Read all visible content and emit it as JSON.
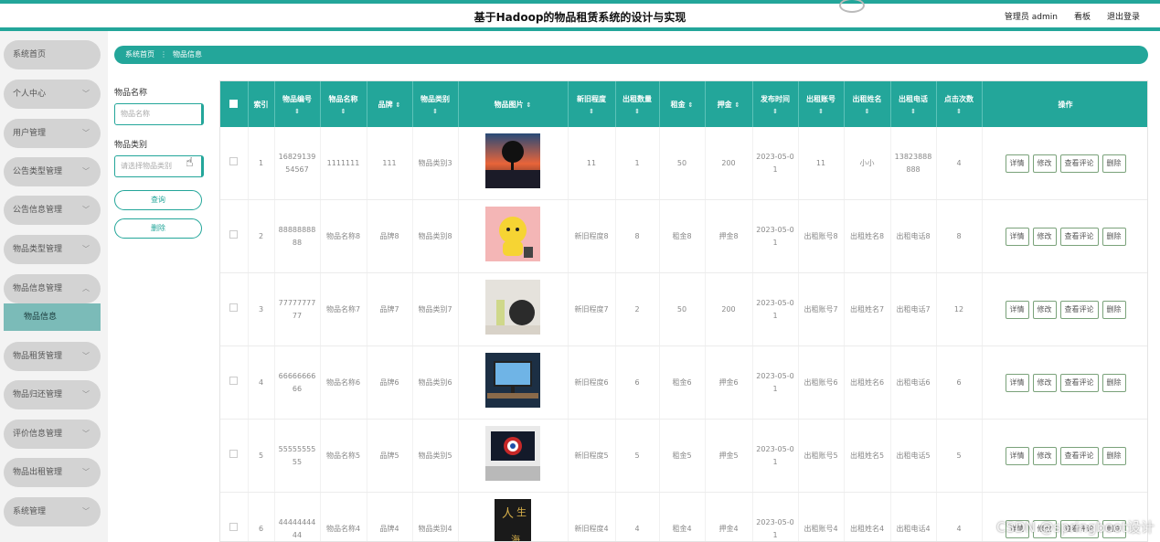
{
  "header": {
    "title": "基于Hadoop的物品租赁系统的设计与实现",
    "user": "管理员 admin",
    "board": "看板",
    "logout": "退出登录"
  },
  "sidebar": {
    "items": [
      {
        "label": "系统首页",
        "chevron": ""
      },
      {
        "label": "个人中心",
        "chevron": "﹀"
      },
      {
        "label": "用户管理",
        "chevron": "﹀"
      },
      {
        "label": "公告类型管理",
        "chevron": "﹀"
      },
      {
        "label": "公告信息管理",
        "chevron": "﹀"
      },
      {
        "label": "物品类型管理",
        "chevron": "﹀"
      },
      {
        "label": "物品信息管理",
        "chevron": "︿"
      },
      {
        "label": "物品租赁管理",
        "chevron": "﹀"
      },
      {
        "label": "物品归还管理",
        "chevron": "﹀"
      },
      {
        "label": "评价信息管理",
        "chevron": "﹀"
      },
      {
        "label": "物品出租管理",
        "chevron": "﹀"
      },
      {
        "label": "系统管理",
        "chevron": "﹀"
      }
    ],
    "active_sub": "物品信息"
  },
  "breadcrumb": {
    "home": "系统首页",
    "sep": "⋮",
    "current": "物品信息"
  },
  "search": {
    "name_label": "物品名称",
    "name_placeholder": "物品名称",
    "type_label": "物品类别",
    "type_placeholder": "请选择物品类别",
    "query_button": "查询",
    "delete_button": "删除"
  },
  "table": {
    "headers": [
      {
        "label": "索引",
        "sort": ""
      },
      {
        "label": "物品编号",
        "sort": "⇕"
      },
      {
        "label": "物品名称",
        "sort": "⇕"
      },
      {
        "label": "品牌",
        "sort": "⇕"
      },
      {
        "label": "物品类别",
        "sort": "⇕"
      },
      {
        "label": "物品图片",
        "sort": "⇕"
      },
      {
        "label": "新旧程度",
        "sort": "⇕"
      },
      {
        "label": "出租数量",
        "sort": "⇕"
      },
      {
        "label": "租金",
        "sort": "⇕"
      },
      {
        "label": "押金",
        "sort": "⇕"
      },
      {
        "label": "发布时间",
        "sort": "⇕"
      },
      {
        "label": "出租账号",
        "sort": "⇕"
      },
      {
        "label": "出租姓名",
        "sort": "⇕"
      },
      {
        "label": "出租电话",
        "sort": "⇕"
      },
      {
        "label": "点击次数",
        "sort": "⇕"
      },
      {
        "label": "操作",
        "sort": ""
      }
    ],
    "ops": [
      "详情",
      "修改",
      "查看评论",
      "删除"
    ],
    "rows": [
      {
        "index": "1",
        "code": "1682913954567",
        "name": "1111111",
        "brand": "111",
        "type": "物品类别3",
        "image": "sunset-tree",
        "condition": "11",
        "qty": "1",
        "rent": "50",
        "deposit": "200",
        "date": "2023-05-01",
        "account": "11",
        "owner": "小小",
        "phone": "13823888888",
        "clicks": "4"
      },
      {
        "index": "2",
        "code": "8888888888",
        "name": "物品名称8",
        "brand": "品牌8",
        "type": "物品类别8",
        "image": "yellow-toy",
        "condition": "新旧程度8",
        "qty": "8",
        "rent": "租金8",
        "deposit": "押金8",
        "date": "2023-05-01",
        "account": "出租账号8",
        "owner": "出租姓名8",
        "phone": "出租电话8",
        "clicks": "8"
      },
      {
        "index": "3",
        "code": "7777777777",
        "name": "物品名称7",
        "brand": "品牌7",
        "type": "物品类别7",
        "image": "desk-items",
        "condition": "新旧程度7",
        "qty": "2",
        "rent": "50",
        "deposit": "200",
        "date": "2023-05-01",
        "account": "出租账号7",
        "owner": "出租姓名7",
        "phone": "出租电话7",
        "clicks": "12"
      },
      {
        "index": "4",
        "code": "6666666666",
        "name": "物品名称6",
        "brand": "品牌6",
        "type": "物品类别6",
        "image": "monitor-desk",
        "condition": "新旧程度6",
        "qty": "6",
        "rent": "租金6",
        "deposit": "押金6",
        "date": "2023-05-01",
        "account": "出租账号6",
        "owner": "出租姓名6",
        "phone": "出租电话6",
        "clicks": "6"
      },
      {
        "index": "5",
        "code": "5555555555",
        "name": "物品名称5",
        "brand": "品牌5",
        "type": "物品类别5",
        "image": "shield-monitor",
        "condition": "新旧程度5",
        "qty": "5",
        "rent": "租金5",
        "deposit": "押金5",
        "date": "2023-05-01",
        "account": "出租账号5",
        "owner": "出租姓名5",
        "phone": "出租电话5",
        "clicks": "5"
      },
      {
        "index": "6",
        "code": "4444444444",
        "name": "物品名称4",
        "brand": "品牌4",
        "type": "物品类别4",
        "image": "book-cover",
        "condition": "新旧程度4",
        "qty": "4",
        "rent": "租金4",
        "deposit": "押金4",
        "date": "2023-05-01",
        "account": "出租账号4",
        "owner": "出租姓名4",
        "phone": "出租电话4",
        "clicks": "4"
      }
    ]
  },
  "watermark": "CSDN @springboot设计"
}
